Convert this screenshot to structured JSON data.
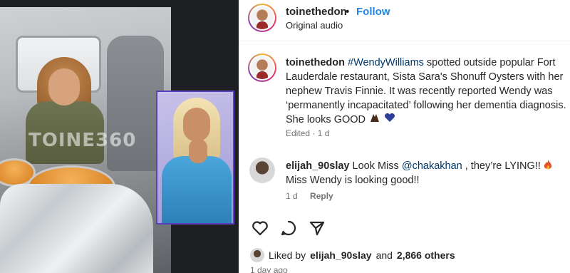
{
  "media": {
    "watermark": "TOINE360"
  },
  "header": {
    "username": "toinethedon",
    "separator": "•",
    "follow_label": "Follow",
    "audio_label": "Original audio"
  },
  "caption": {
    "username": "toinethedon",
    "hashtag": "#WendyWilliams",
    "text": " spotted outside popular Fort Lauderdale restaurant, Sista Sara's Shonuff Oysters with her nephew Travis Finnie. It was recently reported Wendy was ‘permanently incapacitated’ following her dementia diagnosis. She looks GOOD ",
    "emojis": [
      "hands-icon",
      "blue-heart-icon"
    ],
    "meta": "Edited · 1 d"
  },
  "comment": {
    "username": "elijah_90slay",
    "text_before": " Look Miss ",
    "mention": "@chakakhan",
    "text_after": " , they’re LYING!! ",
    "text_end": " Miss Wendy is looking good!!",
    "emoji": "fire-icon",
    "age": "1 d",
    "reply_label": "Reply"
  },
  "actions": {
    "icons": [
      "heart-icon",
      "comment-icon",
      "share-icon"
    ]
  },
  "likes": {
    "prefix": "Liked by",
    "user": "elijah_90slay",
    "and": "and",
    "others": "2,866 others"
  },
  "date": "1 day ago"
}
